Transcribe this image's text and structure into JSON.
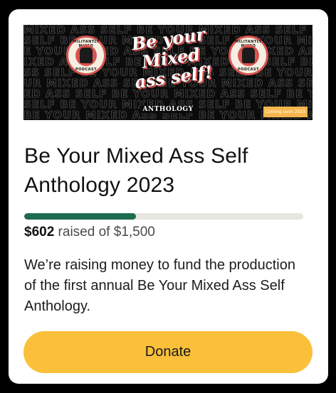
{
  "banner": {
    "headline_lines": [
      "Be your",
      "Mixed",
      "ass self!"
    ],
    "anthology_label": "ANTHOLOGY",
    "coming_soon": "Coming soon 2023",
    "badge_text_top": "MILITANTLY MIXED",
    "badge_text_bottom": "PODCAST",
    "pattern_rows": [
      "MIXED ASS SELF BE YOUR MIXED ASS SELF BE YOUR MIXED",
      "SELF BE YOUR MIXED ASS SELF BE YOUR MIXED ASS SELF",
      "E YOUR MIXED ASS SELF BE YOUR MIXED ASS SELF BE YOUR",
      "IXED ASS SELF BE YOUR MIXED ASS SELF BE YOUR MIXED",
      "SS SELF BE YOUR MIXED ASS SELF BE YOUR MIXED ASS SELF",
      "UR MIXED ASS SELF BE YOUR MIXED ASS SELF BE YOUR MI",
      "ED ASS SELF BE YOUR MIXED ASS SELF BE YOUR MIXED ASS",
      "SELF BE YOUR MIXED ASS SELF BE YOUR MIXED ASS SELF B",
      "BE YOUR MIXED ASS SELF BE YOUR MIXED ASS SELF BE YO"
    ]
  },
  "campaign": {
    "title": "Be Your Mixed Ass Self Anthology 2023",
    "raised_amount": "$602",
    "raised_suffix": " raised of $1,500",
    "progress_fraction": 0.401,
    "description": "We’re raising money to fund the production of the first annual Be Your Mixed Ass Self Anthology."
  },
  "actions": {
    "donate_label": "Donate"
  },
  "colors": {
    "progress": "#1f6b4f",
    "track": "#e8e6e1",
    "donate_bg": "#fbc03a",
    "banner_accent": "#d9534f"
  }
}
